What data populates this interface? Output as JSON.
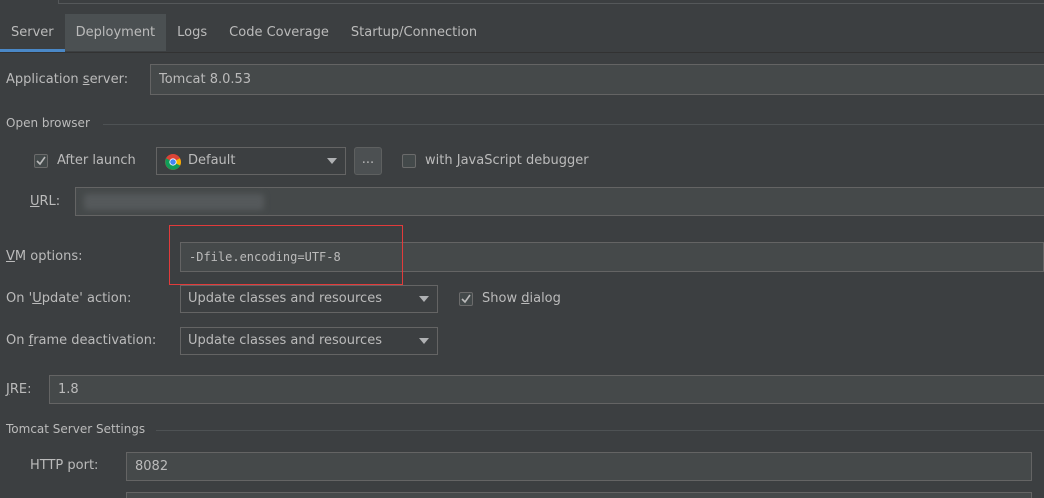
{
  "tabs": [
    {
      "label": "Server",
      "active": true
    },
    {
      "label": "Deployment"
    },
    {
      "label": "Logs"
    },
    {
      "label": "Code Coverage"
    },
    {
      "label": "Startup/Connection"
    }
  ],
  "app_server": {
    "label_pre": "Application ",
    "label_u": "s",
    "label_post": "erver:",
    "value": "Tomcat 8.0.53"
  },
  "open_browser": {
    "title": "Open browser",
    "after_launch_label": "After launch",
    "after_launch_checked": true,
    "browser_value": "Default",
    "browse_button": "...",
    "js_debugger_pre": "with ",
    "js_debugger_u": "J",
    "js_debugger_post": "avaScript debugger",
    "js_debugger_checked": false,
    "url_label_u": "U",
    "url_label_post": "RL:"
  },
  "vm_options": {
    "label_u": "V",
    "label_post": "M options:",
    "value": "-Dfile.encoding=UTF-8"
  },
  "update_action": {
    "label_pre": "On '",
    "label_u": "U",
    "label_post": "pdate' action:",
    "value": "Update classes and resources",
    "show_dialog_pre": "Show ",
    "show_dialog_u": "d",
    "show_dialog_post": "ialog",
    "show_dialog_checked": true
  },
  "frame_deactivation": {
    "label_pre": "On ",
    "label_u": "f",
    "label_post": "rame deactivation:",
    "value": "Update classes and resources"
  },
  "jre": {
    "label_u": "J",
    "label_post": "RE:",
    "value": "1.8"
  },
  "tomcat_settings": {
    "title": "Tomcat Server Settings",
    "http_port_label": "HTTP port:",
    "http_port_value": "8082"
  },
  "colors": {
    "accent": "#4a88c7",
    "highlight": "#e23b3b",
    "background": "#3c3f41"
  }
}
